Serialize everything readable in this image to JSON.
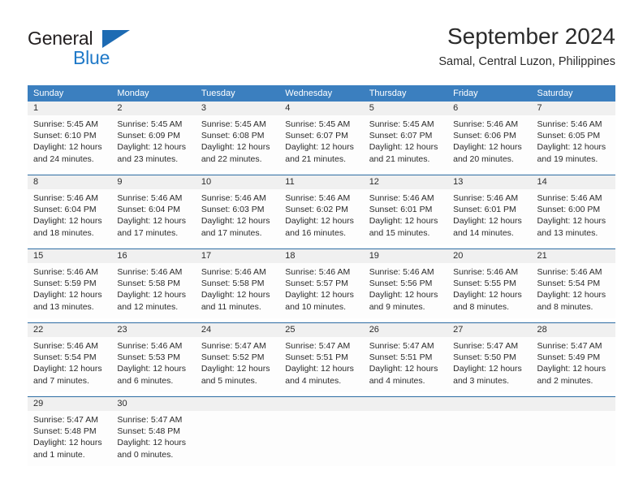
{
  "logo": {
    "word_top": "General",
    "word_bottom": "Blue",
    "triangle_color": "#1d6bb3",
    "blue_text_color": "#1f79c8"
  },
  "header": {
    "title": "September 2024",
    "subtitle": "Samal, Central Luzon, Philippines"
  },
  "theme": {
    "header_bar_color": "#3b7fbf",
    "row_divider_color": "#2e6da4",
    "daynum_band_color": "#f0f0f0"
  },
  "weekdays": [
    "Sunday",
    "Monday",
    "Tuesday",
    "Wednesday",
    "Thursday",
    "Friday",
    "Saturday"
  ],
  "weeks": [
    {
      "days": [
        {
          "num": "1",
          "l1": "Sunrise: 5:45 AM",
          "l2": "Sunset: 6:10 PM",
          "l3": "Daylight: 12 hours",
          "l4": "and 24 minutes."
        },
        {
          "num": "2",
          "l1": "Sunrise: 5:45 AM",
          "l2": "Sunset: 6:09 PM",
          "l3": "Daylight: 12 hours",
          "l4": "and 23 minutes."
        },
        {
          "num": "3",
          "l1": "Sunrise: 5:45 AM",
          "l2": "Sunset: 6:08 PM",
          "l3": "Daylight: 12 hours",
          "l4": "and 22 minutes."
        },
        {
          "num": "4",
          "l1": "Sunrise: 5:45 AM",
          "l2": "Sunset: 6:07 PM",
          "l3": "Daylight: 12 hours",
          "l4": "and 21 minutes."
        },
        {
          "num": "5",
          "l1": "Sunrise: 5:45 AM",
          "l2": "Sunset: 6:07 PM",
          "l3": "Daylight: 12 hours",
          "l4": "and 21 minutes."
        },
        {
          "num": "6",
          "l1": "Sunrise: 5:46 AM",
          "l2": "Sunset: 6:06 PM",
          "l3": "Daylight: 12 hours",
          "l4": "and 20 minutes."
        },
        {
          "num": "7",
          "l1": "Sunrise: 5:46 AM",
          "l2": "Sunset: 6:05 PM",
          "l3": "Daylight: 12 hours",
          "l4": "and 19 minutes."
        }
      ]
    },
    {
      "days": [
        {
          "num": "8",
          "l1": "Sunrise: 5:46 AM",
          "l2": "Sunset: 6:04 PM",
          "l3": "Daylight: 12 hours",
          "l4": "and 18 minutes."
        },
        {
          "num": "9",
          "l1": "Sunrise: 5:46 AM",
          "l2": "Sunset: 6:04 PM",
          "l3": "Daylight: 12 hours",
          "l4": "and 17 minutes."
        },
        {
          "num": "10",
          "l1": "Sunrise: 5:46 AM",
          "l2": "Sunset: 6:03 PM",
          "l3": "Daylight: 12 hours",
          "l4": "and 17 minutes."
        },
        {
          "num": "11",
          "l1": "Sunrise: 5:46 AM",
          "l2": "Sunset: 6:02 PM",
          "l3": "Daylight: 12 hours",
          "l4": "and 16 minutes."
        },
        {
          "num": "12",
          "l1": "Sunrise: 5:46 AM",
          "l2": "Sunset: 6:01 PM",
          "l3": "Daylight: 12 hours",
          "l4": "and 15 minutes."
        },
        {
          "num": "13",
          "l1": "Sunrise: 5:46 AM",
          "l2": "Sunset: 6:01 PM",
          "l3": "Daylight: 12 hours",
          "l4": "and 14 minutes."
        },
        {
          "num": "14",
          "l1": "Sunrise: 5:46 AM",
          "l2": "Sunset: 6:00 PM",
          "l3": "Daylight: 12 hours",
          "l4": "and 13 minutes."
        }
      ]
    },
    {
      "days": [
        {
          "num": "15",
          "l1": "Sunrise: 5:46 AM",
          "l2": "Sunset: 5:59 PM",
          "l3": "Daylight: 12 hours",
          "l4": "and 13 minutes."
        },
        {
          "num": "16",
          "l1": "Sunrise: 5:46 AM",
          "l2": "Sunset: 5:58 PM",
          "l3": "Daylight: 12 hours",
          "l4": "and 12 minutes."
        },
        {
          "num": "17",
          "l1": "Sunrise: 5:46 AM",
          "l2": "Sunset: 5:58 PM",
          "l3": "Daylight: 12 hours",
          "l4": "and 11 minutes."
        },
        {
          "num": "18",
          "l1": "Sunrise: 5:46 AM",
          "l2": "Sunset: 5:57 PM",
          "l3": "Daylight: 12 hours",
          "l4": "and 10 minutes."
        },
        {
          "num": "19",
          "l1": "Sunrise: 5:46 AM",
          "l2": "Sunset: 5:56 PM",
          "l3": "Daylight: 12 hours",
          "l4": "and 9 minutes."
        },
        {
          "num": "20",
          "l1": "Sunrise: 5:46 AM",
          "l2": "Sunset: 5:55 PM",
          "l3": "Daylight: 12 hours",
          "l4": "and 8 minutes."
        },
        {
          "num": "21",
          "l1": "Sunrise: 5:46 AM",
          "l2": "Sunset: 5:54 PM",
          "l3": "Daylight: 12 hours",
          "l4": "and 8 minutes."
        }
      ]
    },
    {
      "days": [
        {
          "num": "22",
          "l1": "Sunrise: 5:46 AM",
          "l2": "Sunset: 5:54 PM",
          "l3": "Daylight: 12 hours",
          "l4": "and 7 minutes."
        },
        {
          "num": "23",
          "l1": "Sunrise: 5:46 AM",
          "l2": "Sunset: 5:53 PM",
          "l3": "Daylight: 12 hours",
          "l4": "and 6 minutes."
        },
        {
          "num": "24",
          "l1": "Sunrise: 5:47 AM",
          "l2": "Sunset: 5:52 PM",
          "l3": "Daylight: 12 hours",
          "l4": "and 5 minutes."
        },
        {
          "num": "25",
          "l1": "Sunrise: 5:47 AM",
          "l2": "Sunset: 5:51 PM",
          "l3": "Daylight: 12 hours",
          "l4": "and 4 minutes."
        },
        {
          "num": "26",
          "l1": "Sunrise: 5:47 AM",
          "l2": "Sunset: 5:51 PM",
          "l3": "Daylight: 12 hours",
          "l4": "and 4 minutes."
        },
        {
          "num": "27",
          "l1": "Sunrise: 5:47 AM",
          "l2": "Sunset: 5:50 PM",
          "l3": "Daylight: 12 hours",
          "l4": "and 3 minutes."
        },
        {
          "num": "28",
          "l1": "Sunrise: 5:47 AM",
          "l2": "Sunset: 5:49 PM",
          "l3": "Daylight: 12 hours",
          "l4": "and 2 minutes."
        }
      ]
    },
    {
      "days": [
        {
          "num": "29",
          "l1": "Sunrise: 5:47 AM",
          "l2": "Sunset: 5:48 PM",
          "l3": "Daylight: 12 hours",
          "l4": "and 1 minute."
        },
        {
          "num": "30",
          "l1": "Sunrise: 5:47 AM",
          "l2": "Sunset: 5:48 PM",
          "l3": "Daylight: 12 hours",
          "l4": "and 0 minutes."
        },
        {
          "num": "",
          "l1": "",
          "l2": "",
          "l3": "",
          "l4": ""
        },
        {
          "num": "",
          "l1": "",
          "l2": "",
          "l3": "",
          "l4": ""
        },
        {
          "num": "",
          "l1": "",
          "l2": "",
          "l3": "",
          "l4": ""
        },
        {
          "num": "",
          "l1": "",
          "l2": "",
          "l3": "",
          "l4": ""
        },
        {
          "num": "",
          "l1": "",
          "l2": "",
          "l3": "",
          "l4": ""
        }
      ]
    }
  ]
}
